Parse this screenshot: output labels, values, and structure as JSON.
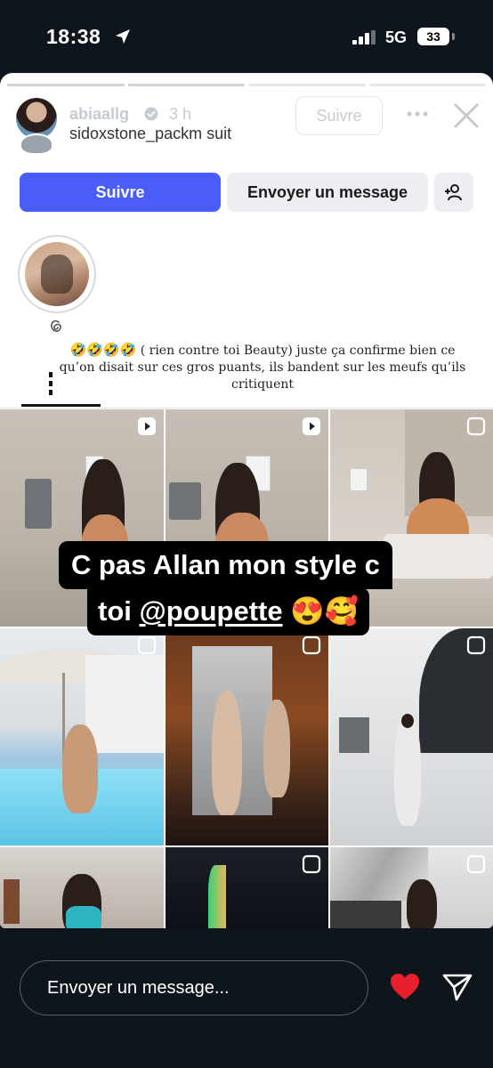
{
  "status_bar": {
    "time": "18:38",
    "network": "5G",
    "battery": "33"
  },
  "story": {
    "username": "abiaallg",
    "time_ago": "3 h",
    "follows_user": "sidoxstone_packm",
    "follows_suffix": "suit",
    "follow_ghost_label": "Suivre",
    "buttons": {
      "follow": "Suivre",
      "message": "Envoyer un message"
    },
    "caption_emojis": "🤣🤣🤣🤣",
    "caption_text": "( rien contre toi Beauty) juste ça confirme bien ce qu’on disait sur ces gros puants, ils bandent sur les meufs qu’ils critiquent",
    "sticker": {
      "line1": "C pas Allan mon style c",
      "line2_prefix": "toi ",
      "mention": "@poupette",
      "emojis": " 😍🥰"
    }
  },
  "reply": {
    "placeholder": "Envoyer un message..."
  },
  "colors": {
    "accent_blue": "#4a5df9",
    "heart_red": "#e8202e",
    "background": "#0f151c"
  },
  "icons": [
    "location-arrow-icon",
    "signal-icon",
    "battery-icon",
    "verified-icon",
    "more-icon",
    "close-icon",
    "add-person-icon",
    "threads-icon",
    "reel-icon",
    "carousel-icon",
    "heart-icon",
    "send-icon"
  ]
}
